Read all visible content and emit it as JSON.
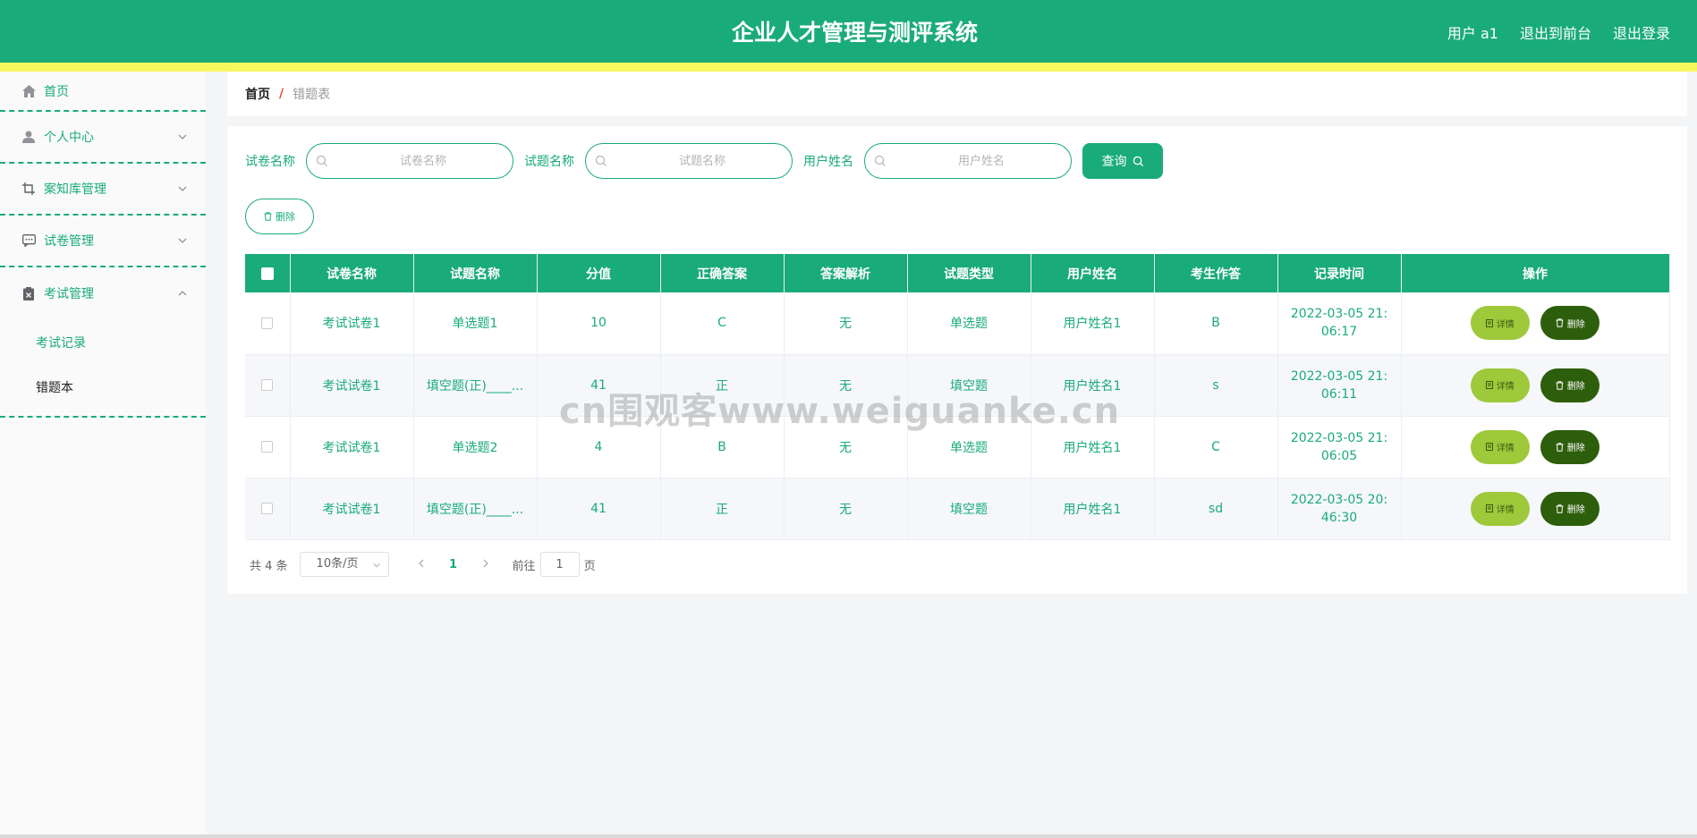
{
  "header": {
    "title": "企业人才管理与测评系统",
    "user_label": "用户 a1",
    "back_front_label": "退出到前台",
    "logout_label": "退出登录"
  },
  "sidebar": {
    "items": [
      {
        "label": "首页",
        "icon": "home-icon"
      },
      {
        "label": "个人中心",
        "icon": "user-icon"
      },
      {
        "label": "案知库管理",
        "icon": "crop-icon"
      },
      {
        "label": "试卷管理",
        "icon": "chat-icon"
      },
      {
        "label": "考试管理",
        "icon": "clipboard-icon"
      }
    ],
    "subitems": [
      {
        "label": "考试记录"
      },
      {
        "label": "错题本"
      }
    ]
  },
  "breadcrumb": {
    "home": "首页",
    "separator": "/",
    "current": "错题表"
  },
  "search": {
    "paper_label": "试卷名称",
    "paper_placeholder": "试卷名称",
    "question_label": "试题名称",
    "question_placeholder": "试题名称",
    "user_label": "用户姓名",
    "user_placeholder": "用户姓名",
    "query_label": "查询"
  },
  "actions": {
    "delete_label": "删除"
  },
  "table": {
    "columns": [
      "试卷名称",
      "试题名称",
      "分值",
      "正确答案",
      "答案解析",
      "试题类型",
      "用户姓名",
      "考生作答",
      "记录时间",
      "操作"
    ],
    "detail_label": "详情",
    "delete_label": "删除",
    "rows": [
      {
        "paper": "考试试卷1",
        "question": "单选题1",
        "score": "10",
        "answer": "C",
        "analysis": "无",
        "type": "单选题",
        "user": "用户姓名1",
        "response": "B",
        "time": "2022-03-05 21:06:17"
      },
      {
        "paper": "考试试卷1",
        "question": "填空题(正)____...",
        "score": "41",
        "answer": "正",
        "analysis": "无",
        "type": "填空题",
        "user": "用户姓名1",
        "response": "s",
        "time": "2022-03-05 21:06:11"
      },
      {
        "paper": "考试试卷1",
        "question": "单选题2",
        "score": "4",
        "answer": "B",
        "analysis": "无",
        "type": "单选题",
        "user": "用户姓名1",
        "response": "C",
        "time": "2022-03-05 21:06:05"
      },
      {
        "paper": "考试试卷1",
        "question": "填空题(正)____...",
        "score": "41",
        "answer": "正",
        "analysis": "无",
        "type": "填空题",
        "user": "用户姓名1",
        "response": "sd",
        "time": "2022-03-05 20:46:30"
      }
    ]
  },
  "pagination": {
    "total": "共 4 条",
    "page_size": "10条/页",
    "current_page": "1",
    "goto_label": "前往",
    "goto_value": "1",
    "page_suffix": "页"
  },
  "watermark": "cn围观客www.weiguanke.cn",
  "colors": {
    "primary": "#1aab7a",
    "stripe": "#f7f75e",
    "detail_button": "#9dc93a",
    "delete_button": "#2d5e0c"
  }
}
